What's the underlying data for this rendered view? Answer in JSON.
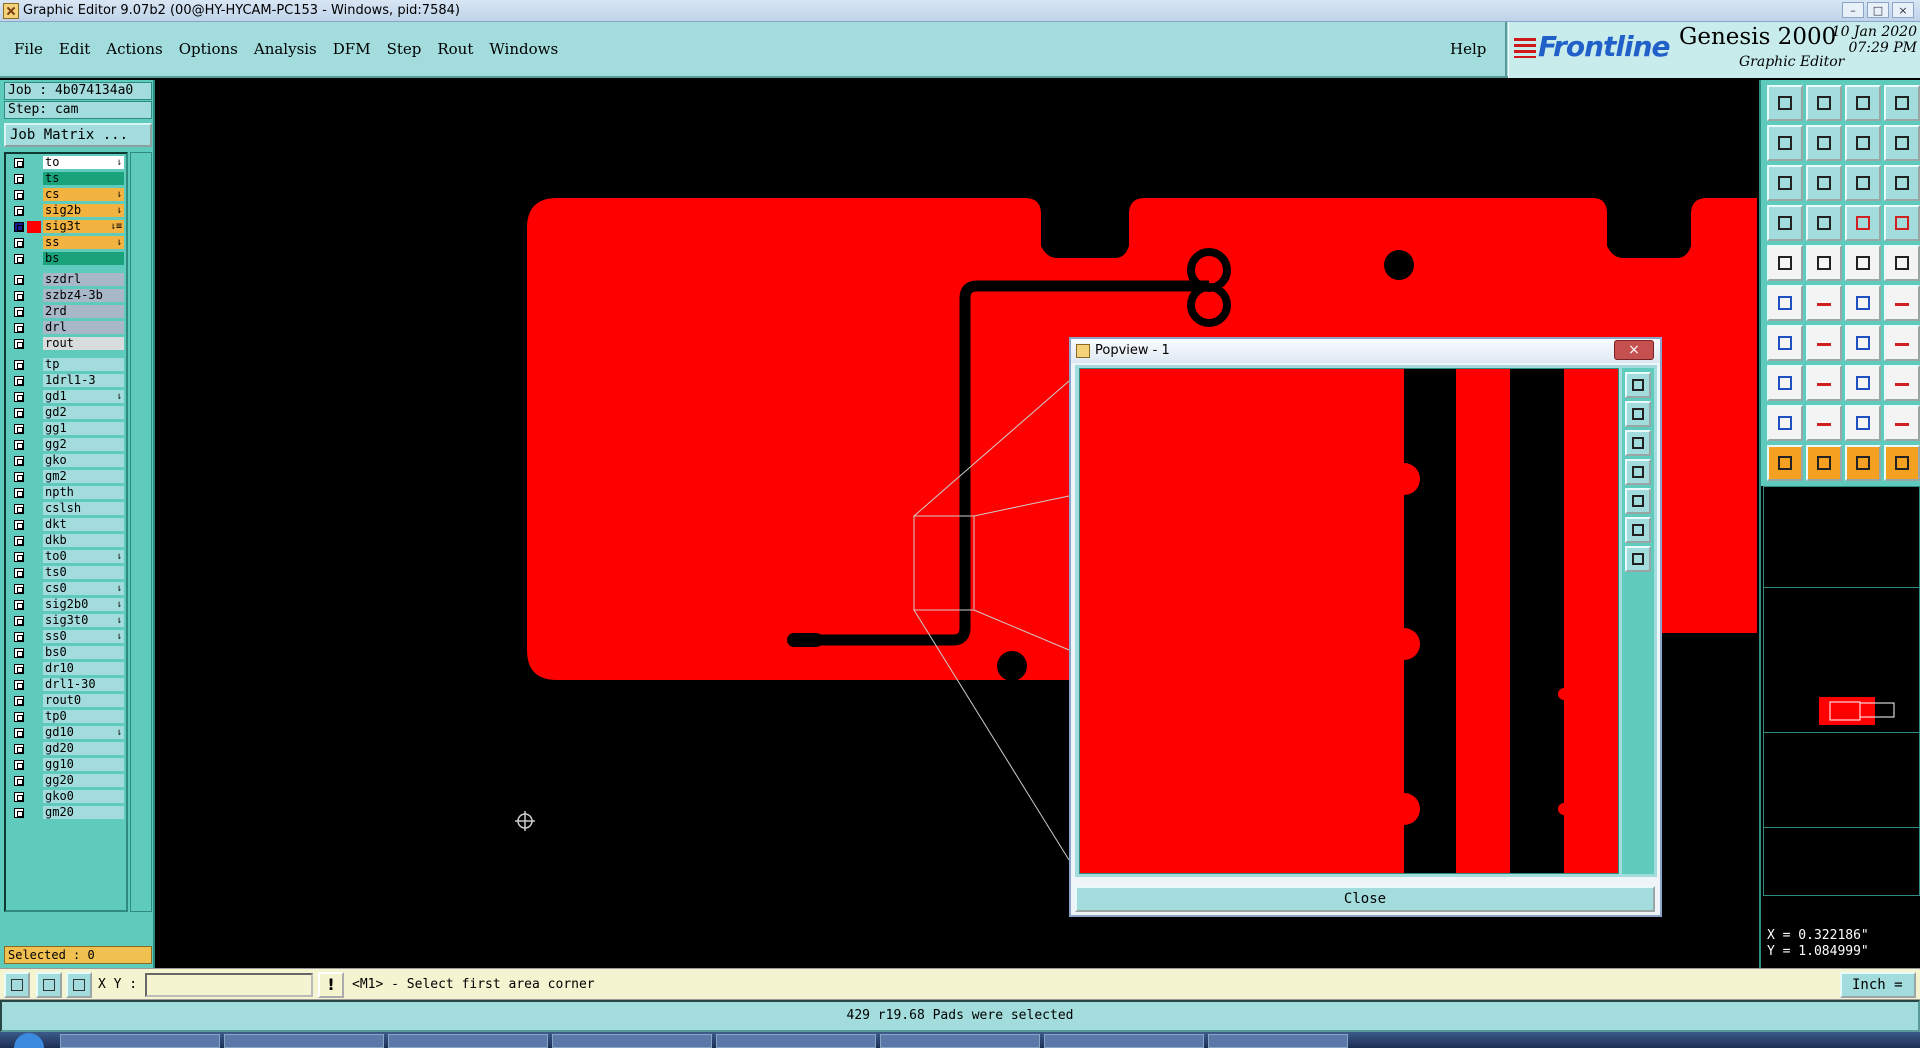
{
  "window": {
    "title": "Graphic Editor 9.07b2 (00@HY-HYCAM-PC153 - Windows, pid:7584)"
  },
  "menu": {
    "items": [
      "File",
      "Edit",
      "Actions",
      "Options",
      "Analysis",
      "DFM",
      "Step",
      "Rout",
      "Windows"
    ],
    "help": "Help"
  },
  "brand": {
    "logo": "Frontline",
    "product": "Genesis 2000",
    "subtitle": "Graphic Editor",
    "date": "10 Jan 2020",
    "time": "07:29 PM"
  },
  "job": {
    "job_label": "Job : 4b074134a0",
    "step_label": "Step: cam",
    "job_matrix": "Job Matrix ..."
  },
  "layers": [
    {
      "name": "to",
      "color": "#ffffff",
      "mark": "⇂"
    },
    {
      "name": "ts",
      "color": "#1aa37a",
      "mark": ""
    },
    {
      "name": "cs",
      "color": "#f2b340",
      "mark": "⇂"
    },
    {
      "name": "sig2b",
      "color": "#f2b340",
      "mark": "⇂"
    },
    {
      "name": "sig3t",
      "color": "#f2b340",
      "mark": "⇂≡",
      "active": true
    },
    {
      "name": "ss",
      "color": "#f2b340",
      "mark": "⇂"
    },
    {
      "name": "bs",
      "color": "#1aa37a",
      "mark": ""
    },
    {
      "name": "szdrl",
      "color": "#a8b8c8",
      "mark": ""
    },
    {
      "name": "szbz4-3b",
      "color": "#a8b8c8",
      "mark": ""
    },
    {
      "name": "2rd",
      "color": "#a8b8c8",
      "mark": ""
    },
    {
      "name": "drl",
      "color": "#a8b8c8",
      "mark": ""
    },
    {
      "name": "rout",
      "color": "#d8dcdc",
      "mark": ""
    },
    {
      "name": "tp",
      "color": "#a2dcdc",
      "mark": ""
    },
    {
      "name": "1drl1-3",
      "color": "#a2dcdc",
      "mark": ""
    },
    {
      "name": "gd1",
      "color": "#a2dcdc",
      "mark": "⇂"
    },
    {
      "name": "gd2",
      "color": "#a2dcdc",
      "mark": ""
    },
    {
      "name": "gg1",
      "color": "#a2dcdc",
      "mark": ""
    },
    {
      "name": "gg2",
      "color": "#a2dcdc",
      "mark": ""
    },
    {
      "name": "gko",
      "color": "#a2dcdc",
      "mark": ""
    },
    {
      "name": "gm2",
      "color": "#a2dcdc",
      "mark": ""
    },
    {
      "name": "npth",
      "color": "#a2dcdc",
      "mark": ""
    },
    {
      "name": "cslsh",
      "color": "#a2dcdc",
      "mark": ""
    },
    {
      "name": "dkt",
      "color": "#a2dcdc",
      "mark": ""
    },
    {
      "name": "dkb",
      "color": "#a2dcdc",
      "mark": ""
    },
    {
      "name": "to0",
      "color": "#a2dcdc",
      "mark": "⇂"
    },
    {
      "name": "ts0",
      "color": "#a2dcdc",
      "mark": ""
    },
    {
      "name": "cs0",
      "color": "#a2dcdc",
      "mark": "⇂"
    },
    {
      "name": "sig2b0",
      "color": "#a2dcdc",
      "mark": "⇂"
    },
    {
      "name": "sig3t0",
      "color": "#a2dcdc",
      "mark": "⇂"
    },
    {
      "name": "ss0",
      "color": "#a2dcdc",
      "mark": "⇂"
    },
    {
      "name": "bs0",
      "color": "#a2dcdc",
      "mark": ""
    },
    {
      "name": "dr10",
      "color": "#a2dcdc",
      "mark": ""
    },
    {
      "name": "drl1-30",
      "color": "#a2dcdc",
      "mark": ""
    },
    {
      "name": "rout0",
      "color": "#a2dcdc",
      "mark": ""
    },
    {
      "name": "tp0",
      "color": "#a2dcdc",
      "mark": ""
    },
    {
      "name": "gd10",
      "color": "#a2dcdc",
      "mark": "⇂"
    },
    {
      "name": "gd20",
      "color": "#a2dcdc",
      "mark": ""
    },
    {
      "name": "gg10",
      "color": "#a2dcdc",
      "mark": ""
    },
    {
      "name": "gg20",
      "color": "#a2dcdc",
      "mark": ""
    },
    {
      "name": "gko0",
      "color": "#a2dcdc",
      "mark": ""
    },
    {
      "name": "gm20",
      "color": "#a2dcdc",
      "mark": ""
    }
  ],
  "selected": "Selected : 0",
  "popview": {
    "title": "Popview - 1",
    "close_x": "×",
    "close_button": "Close"
  },
  "coords": {
    "x": "X = 0.322186\"",
    "y": "Y = 1.084999\""
  },
  "command": {
    "xy_label": "X Y :",
    "xy_value": "",
    "bang": "!",
    "prompt": "<M1> - Select first area corner",
    "unit": "Inch ="
  },
  "status": "429 r19.68 Pads were selected",
  "colors": {
    "feature": "#ff0000",
    "panel": "#5fcbbd",
    "menu": "#a2dcdc"
  }
}
